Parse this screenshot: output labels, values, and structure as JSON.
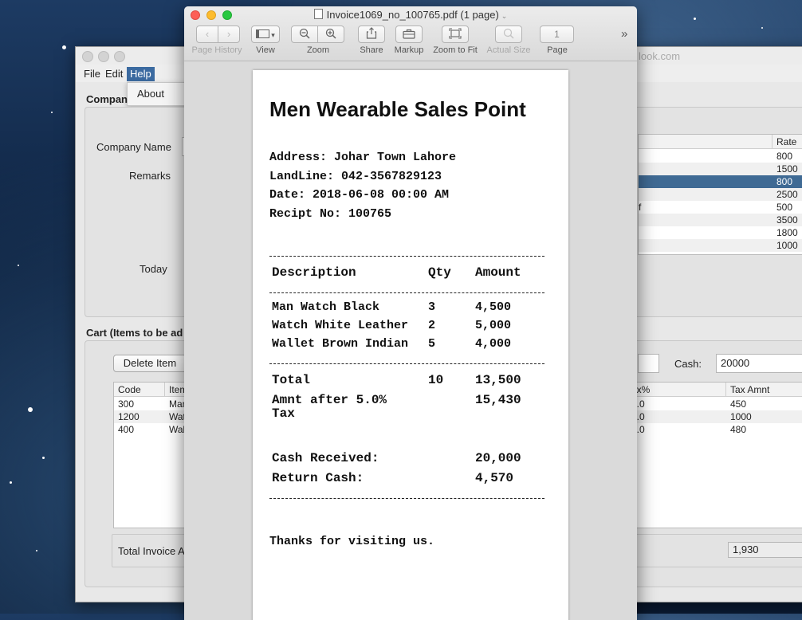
{
  "app": {
    "title_fragment": "look.com",
    "menus": [
      "File",
      "Edit",
      "Help"
    ],
    "help_menu_item": "About",
    "company_section_title": "Compan",
    "company_name_label": "Company Name",
    "remarks_label": "Remarks",
    "today_label": "Today",
    "products_table": {
      "header_rate": "Rate",
      "rates": [
        "800",
        "1500",
        "800",
        "2500",
        "500",
        "3500",
        "1800",
        "1000"
      ],
      "fragment_text": "f",
      "selected_row": 2
    },
    "cart_section_title": "Cart (Items to be ad",
    "delete_button": "Delete Item",
    "cash_label": "Cash:",
    "cash_value": "20000",
    "cart_table": {
      "header_code": "Code",
      "header_item": "Item",
      "header_tax": "ax%",
      "header_tax_amount": "Tax Amnt",
      "rows": [
        {
          "code": "300",
          "item": "Man",
          "tax": "0.0",
          "tax_amount": "450"
        },
        {
          "code": "1200",
          "item": "Wat",
          "tax": "0.0",
          "tax_amount": "1000"
        },
        {
          "code": "400",
          "item": "Wal",
          "tax": "2.0",
          "tax_amount": "480"
        }
      ]
    },
    "total_invoice_label": "Total Invoice A",
    "total_invoice_value": "1,930"
  },
  "preview": {
    "window_title": "Invoice1069_no_100765.pdf (1 page)",
    "toolbar": {
      "page_history": "Page History",
      "view": "View",
      "zoom": "Zoom",
      "share": "Share",
      "markup": "Markup",
      "zoom_to_fit": "Zoom to Fit",
      "actual_size": "Actual Size",
      "page": "Page",
      "page_number": "1",
      "more": "»"
    }
  },
  "receipt": {
    "title": "Men Wearable Sales Point",
    "address": "Address: Johar Town Lahore",
    "landline": "LandLine: 042-3567829123",
    "date": "Date: 2018-06-08 00:00 AM",
    "receipt_no": "Recipt No: 100765",
    "columns": {
      "description": "Description",
      "qty": "Qty",
      "amount": "Amount"
    },
    "items": [
      {
        "description": "Man Watch Black",
        "qty": "3",
        "amount": "4,500"
      },
      {
        "description": "Watch White Leather",
        "qty": "2",
        "amount": "5,000"
      },
      {
        "description": "Wallet Brown Indian",
        "qty": "5",
        "amount": "4,000"
      }
    ],
    "total_label": "Total",
    "total_qty": "10",
    "total_amount": "13,500",
    "after_tax_label_line1": "Amnt after 5.0%",
    "after_tax_label_line2": "Tax",
    "after_tax_amount": "15,430",
    "cash_received_label": "Cash Received:",
    "cash_received_amount": "20,000",
    "return_cash_label": "Return Cash:",
    "return_cash_amount": "4,570",
    "footer": "Thanks for visiting us."
  },
  "colors": {
    "selection": "#3f6a94",
    "menu_active": "#3b6aa0"
  }
}
